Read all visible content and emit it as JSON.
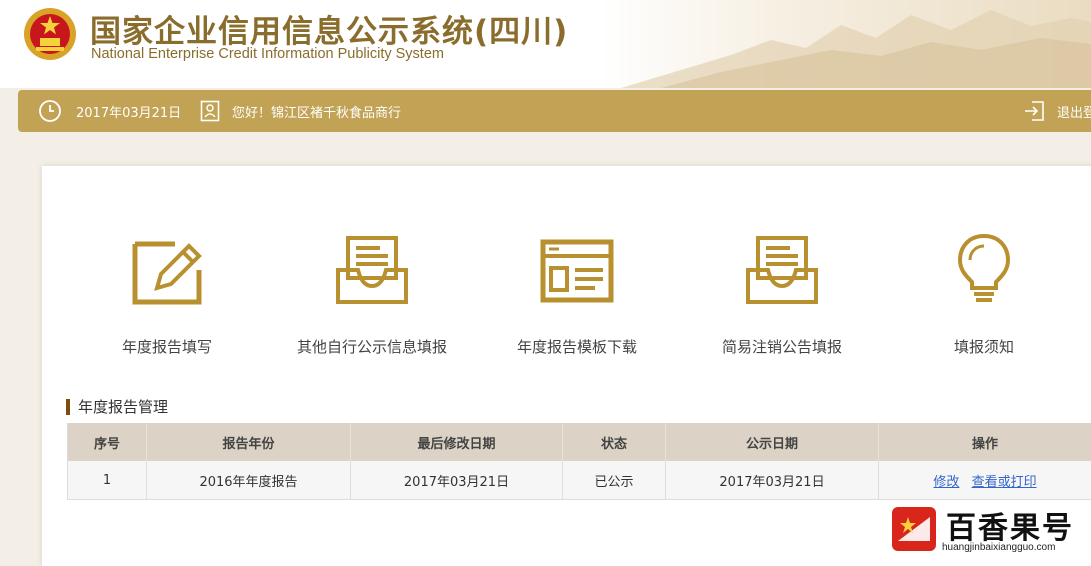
{
  "header": {
    "title_cn": "国家企业信用信息公示系统(四川)",
    "title_en": "National Enterprise Credit Information Publicity System"
  },
  "topbar": {
    "date": "2017年03月21日",
    "greeting": "您好！锦江区褚千秋食品商行",
    "logout": "退出登"
  },
  "features": [
    {
      "label": "年度报告填写",
      "icon": "edit-icon"
    },
    {
      "label": "其他自行公示信息填报",
      "icon": "inbox-tray-icon"
    },
    {
      "label": "年度报告模板下载",
      "icon": "template-icon"
    },
    {
      "label": "简易注销公告填报",
      "icon": "inbox-tray-icon"
    },
    {
      "label": "填报须知",
      "icon": "lightbulb-icon"
    }
  ],
  "section": {
    "title": "年度报告管理"
  },
  "table": {
    "headers": [
      "序号",
      "报告年份",
      "最后修改日期",
      "状态",
      "公示日期",
      "操作"
    ],
    "rows": [
      {
        "index": "1",
        "year": "2016年年度报告",
        "modified": "2017年03月21日",
        "status": "已公示",
        "published": "2017年03月21日",
        "op_edit": "修改",
        "op_view": "查看或打印"
      }
    ]
  },
  "watermark": {
    "cn": "百香果号",
    "en": "huangjinbaixiangguo.com"
  },
  "colors": {
    "accent": "#c2a255",
    "title": "#8a6d2c",
    "icon": "#b8902f",
    "link": "#3366cc"
  }
}
